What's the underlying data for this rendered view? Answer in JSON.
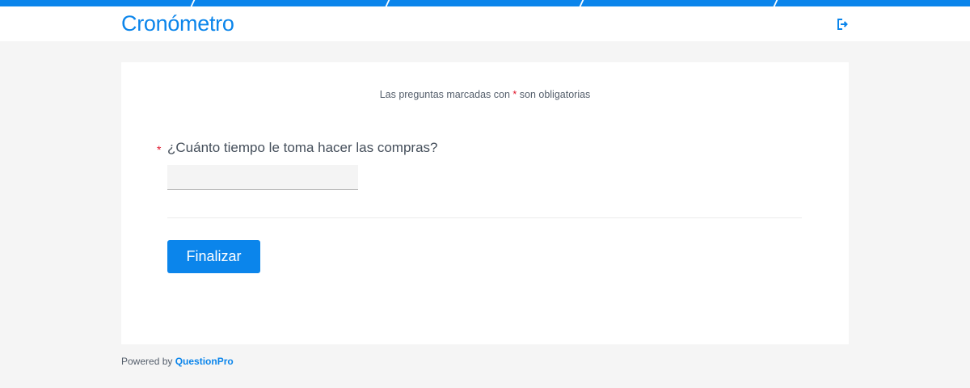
{
  "header": {
    "title": "Cronómetro",
    "logout_icon": "logout-icon"
  },
  "form": {
    "required_note_prefix": "Las preguntas marcadas con",
    "required_marker": "*",
    "required_note_suffix": "son obligatorias",
    "question": {
      "required_marker": "*",
      "label": "¿Cuánto tiempo le toma hacer las compras?",
      "value": ""
    },
    "submit_label": "Finalizar"
  },
  "footer": {
    "powered_by": "Powered by",
    "brand": "QuestionPro"
  },
  "colors": {
    "accent": "#0b85eb",
    "required": "#e0162b",
    "background": "#f5f5f5"
  }
}
